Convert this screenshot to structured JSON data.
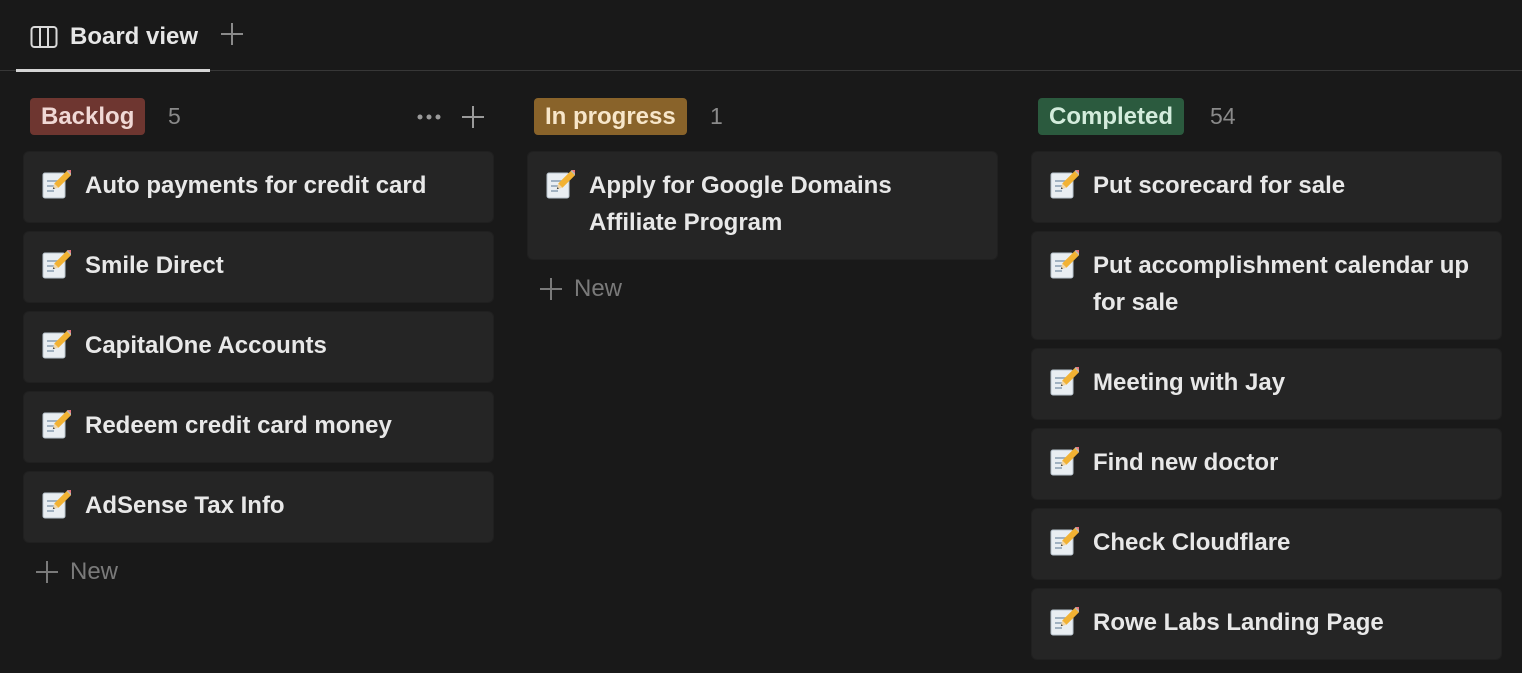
{
  "tab": {
    "label": "Board view"
  },
  "colors": {
    "backlog_tag_bg": "#6e3630",
    "backlog_tag_fg": "#f0d8d5",
    "inprogress_tag_bg": "#89632a",
    "inprogress_tag_fg": "#f7e6c9",
    "completed_tag_bg": "#2b5a3e",
    "completed_tag_fg": "#d3ecdc"
  },
  "columns": [
    {
      "name": "Backlog",
      "count": "5",
      "cards": [
        {
          "title": "Auto payments for credit card",
          "icon": "memo-pencil-icon"
        },
        {
          "title": "Smile Direct",
          "icon": "memo-pencil-icon"
        },
        {
          "title": "CapitalOne Accounts",
          "icon": "memo-pencil-icon"
        },
        {
          "title": "Redeem credit card money",
          "icon": "memo-pencil-icon"
        },
        {
          "title": "AdSense Tax Info",
          "icon": "memo-pencil-icon"
        }
      ],
      "new_label": "New"
    },
    {
      "name": "In progress",
      "count": "1",
      "cards": [
        {
          "title": "Apply for Google Domains Affiliate Program",
          "icon": "memo-pencil-icon"
        }
      ],
      "new_label": "New"
    },
    {
      "name": "Completed",
      "count": "54",
      "cards": [
        {
          "title": "Put scorecard for sale",
          "icon": "memo-pencil-icon"
        },
        {
          "title": "Put accomplishment calendar up for sale",
          "icon": "memo-pencil-icon"
        },
        {
          "title": "Meeting with Jay",
          "icon": "memo-pencil-icon"
        },
        {
          "title": "Find new doctor",
          "icon": "memo-pencil-icon"
        },
        {
          "title": "Check Cloudflare",
          "icon": "memo-pencil-icon"
        },
        {
          "title": "Rowe Labs Landing Page",
          "icon": "memo-pencil-icon"
        }
      ]
    }
  ]
}
